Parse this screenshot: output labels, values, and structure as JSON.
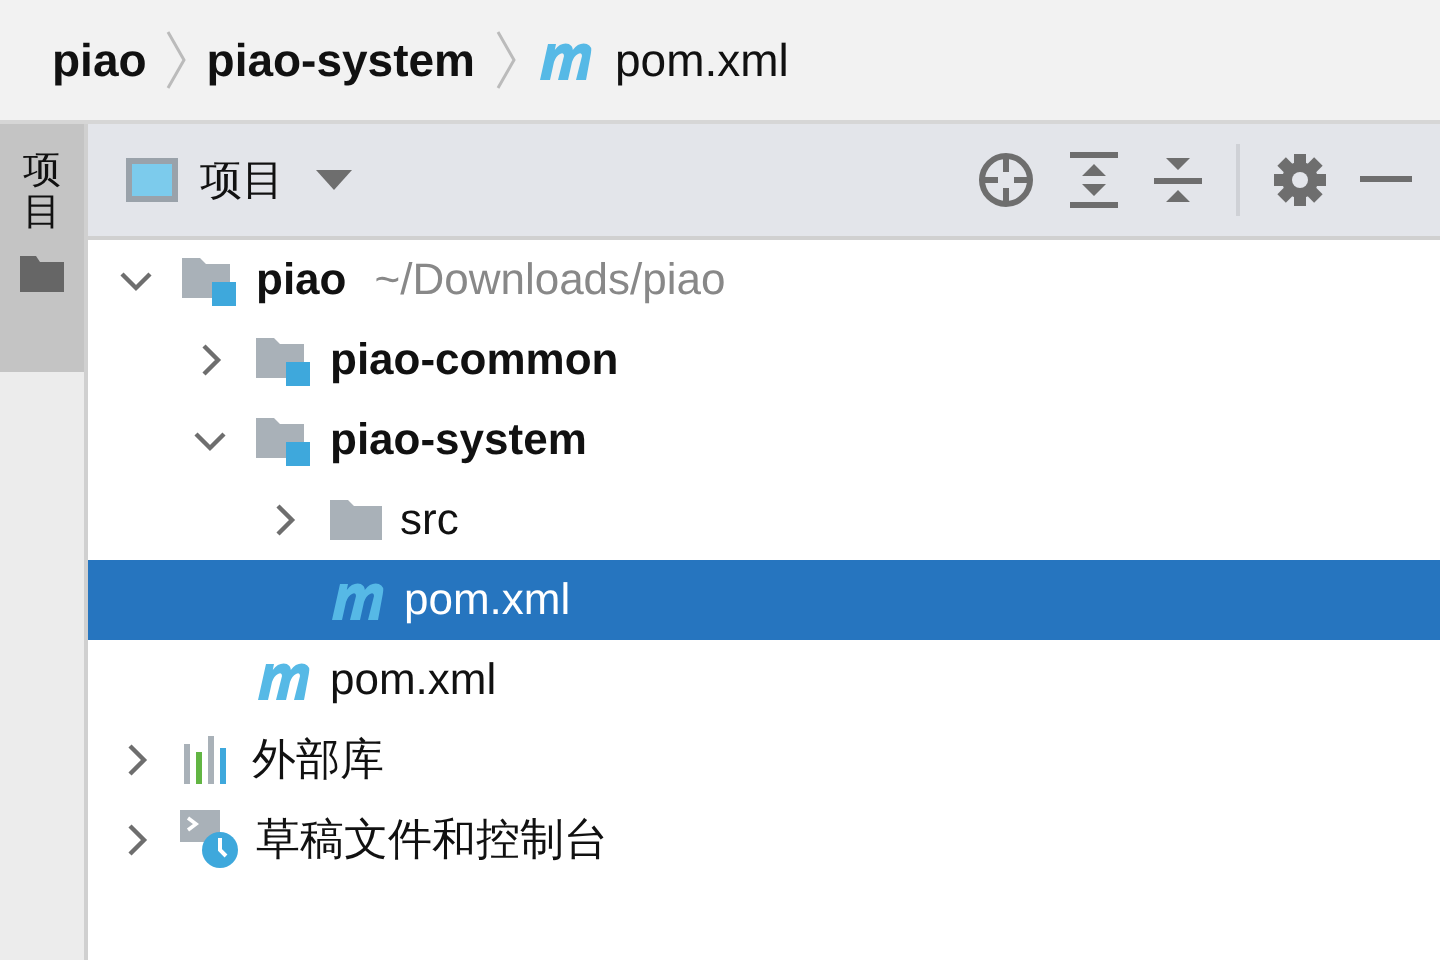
{
  "breadcrumbs": [
    {
      "label": "piao",
      "kind": "module"
    },
    {
      "label": "piao-system",
      "kind": "module"
    },
    {
      "label": "pom.xml",
      "kind": "maven"
    }
  ],
  "side_tab": {
    "label": "项目",
    "selected": true
  },
  "panel": {
    "title": "项目",
    "tools": [
      {
        "kind": "locate"
      },
      {
        "kind": "expand"
      },
      {
        "kind": "collapse"
      },
      {
        "kind": "settings"
      },
      {
        "kind": "hide"
      }
    ]
  },
  "tree": [
    {
      "label": "piao",
      "kind": "module",
      "hint": "~/Downloads/piao",
      "expanded": true,
      "selected": false,
      "children": [
        {
          "label": "piao-common",
          "kind": "module",
          "expanded": false,
          "selected": false
        },
        {
          "label": "piao-system",
          "kind": "module",
          "expanded": true,
          "selected": false,
          "children": [
            {
              "label": "src",
              "kind": "folder",
              "expanded": false,
              "selected": false
            },
            {
              "label": "pom.xml",
              "kind": "maven",
              "selected": true
            }
          ]
        },
        {
          "label": "pom.xml",
          "kind": "maven",
          "selected": false
        }
      ]
    },
    {
      "label": "外部库",
      "kind": "library",
      "expanded": false,
      "selected": false
    },
    {
      "label": "草稿文件和控制台",
      "kind": "scratches",
      "expanded": false,
      "selected": false
    }
  ]
}
